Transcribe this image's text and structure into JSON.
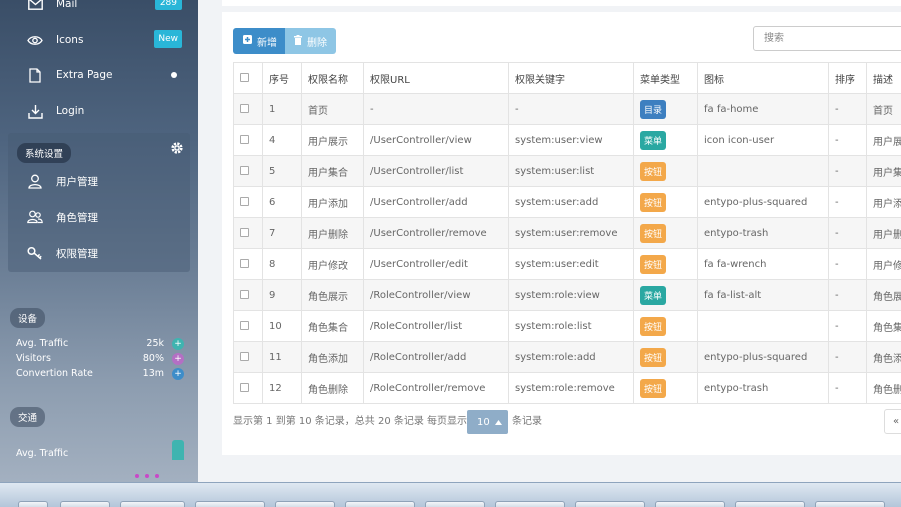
{
  "sidebar": {
    "items": [
      {
        "label": "Mail",
        "icon": "mail-icon",
        "badge": "289"
      },
      {
        "label": "Icons",
        "icon": "eye-icon",
        "badge": "New"
      },
      {
        "label": "Extra Page",
        "icon": "page-icon"
      },
      {
        "label": "Login",
        "icon": "download-icon"
      }
    ],
    "settings": {
      "title": "系统设置",
      "items": [
        {
          "label": "用户管理",
          "icon": "user-icon"
        },
        {
          "label": "角色管理",
          "icon": "users-icon"
        },
        {
          "label": "权限管理",
          "icon": "key-icon"
        }
      ]
    },
    "device": {
      "title": "设备",
      "stats": [
        {
          "label": "Avg. Traffic",
          "value": "25k",
          "color": "#3fb4b0",
          "sign": "+"
        },
        {
          "label": "Visitors",
          "value": "80%",
          "color": "#b46fc4",
          "sign": "+"
        },
        {
          "label": "Convertion Rate",
          "value": "13m",
          "color": "#3d8dc9",
          "sign": "+"
        }
      ]
    },
    "traffic": {
      "title": "交通",
      "label": "Avg. Traffic"
    }
  },
  "toolbar": {
    "add_label": "新增",
    "delete_label": "删除",
    "search_placeholder": "搜索"
  },
  "table": {
    "headers": [
      "序号",
      "权限名称",
      "权限URL",
      "权限关键字",
      "菜单类型",
      "图标",
      "排序",
      "描述"
    ],
    "rows": [
      {
        "id": "1",
        "name": "首页",
        "url": "-",
        "key": "-",
        "type": "目录",
        "type_class": "dir",
        "icon": "fa fa-home",
        "order": "-",
        "desc": "首页"
      },
      {
        "id": "4",
        "name": "用户展示",
        "url": "/UserController/view",
        "key": "system:user:view",
        "type": "菜单",
        "type_class": "menu",
        "icon": "icon icon-user",
        "order": "-",
        "desc": "用户展示"
      },
      {
        "id": "5",
        "name": "用户集合",
        "url": "/UserController/list",
        "key": "system:user:list",
        "type": "按钮",
        "type_class": "btn",
        "icon": "",
        "order": "-",
        "desc": "用户集合"
      },
      {
        "id": "6",
        "name": "用户添加",
        "url": "/UserController/add",
        "key": "system:user:add",
        "type": "按钮",
        "type_class": "btn",
        "icon": "entypo-plus-squared",
        "order": "-",
        "desc": "用户添加"
      },
      {
        "id": "7",
        "name": "用户删除",
        "url": "/UserController/remove",
        "key": "system:user:remove",
        "type": "按钮",
        "type_class": "btn",
        "icon": "entypo-trash",
        "order": "-",
        "desc": "用户删除"
      },
      {
        "id": "8",
        "name": "用户修改",
        "url": "/UserController/edit",
        "key": "system:user:edit",
        "type": "按钮",
        "type_class": "btn",
        "icon": "fa fa-wrench",
        "order": "-",
        "desc": "用户修改"
      },
      {
        "id": "9",
        "name": "角色展示",
        "url": "/RoleController/view",
        "key": "system:role:view",
        "type": "菜单",
        "type_class": "menu",
        "icon": "fa fa-list-alt",
        "order": "-",
        "desc": "角色展示"
      },
      {
        "id": "10",
        "name": "角色集合",
        "url": "/RoleController/list",
        "key": "system:role:list",
        "type": "按钮",
        "type_class": "btn",
        "icon": "",
        "order": "-",
        "desc": "角色集合"
      },
      {
        "id": "11",
        "name": "角色添加",
        "url": "/RoleController/add",
        "key": "system:role:add",
        "type": "按钮",
        "type_class": "btn",
        "icon": "entypo-plus-squared",
        "order": "-",
        "desc": "角色添加"
      },
      {
        "id": "12",
        "name": "角色删除",
        "url": "/RoleController/remove",
        "key": "system:role:remove",
        "type": "按钮",
        "type_class": "btn",
        "icon": "entypo-trash",
        "order": "-",
        "desc": "角色删除"
      }
    ]
  },
  "pagination": {
    "summary": "显示第 1 到第 10 条记录，总共 20 条记录 每页显示",
    "page_size": "10",
    "suffix": "条记录",
    "prev": "«"
  },
  "colors": {
    "primary": "#3d8dc9",
    "menu_tag": "#2aa8a2",
    "button_tag": "#f3a84a",
    "dir_tag": "#3d7fc0"
  }
}
